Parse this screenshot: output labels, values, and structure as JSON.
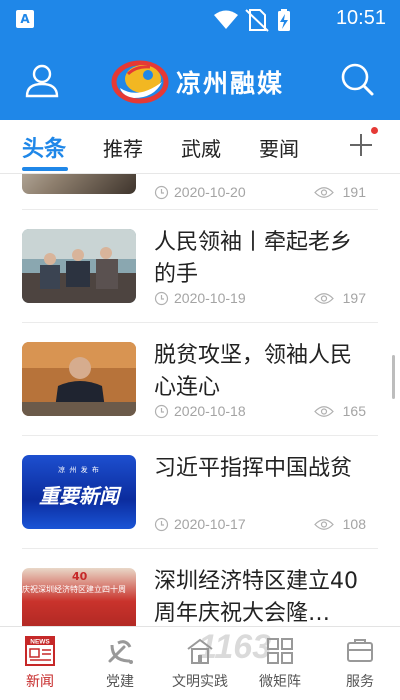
{
  "status_bar": {
    "time": "10:51"
  },
  "header": {
    "app_name": "凉州融媒"
  },
  "tabs": [
    {
      "label": "头条",
      "active": true
    },
    {
      "label": "推荐",
      "active": false
    },
    {
      "label": "武威",
      "active": false
    },
    {
      "label": "要闻",
      "active": false
    }
  ],
  "feed": {
    "items": [
      {
        "title": "",
        "date": "2020-10-20",
        "views": "191"
      },
      {
        "title": "人民领袖丨牵起老乡的手",
        "date": "2020-10-19",
        "views": "197"
      },
      {
        "title": "脱贫攻坚，领袖人民心连心",
        "date": "2020-10-18",
        "views": "165"
      },
      {
        "title": "习近平指挥中国战贫",
        "date": "2020-10-17",
        "views": "108"
      },
      {
        "title": "深圳经济特区建立40周年庆祝大会隆…",
        "date": "",
        "views": ""
      }
    ],
    "thumb_texts": {
      "news_banner": "重要新闻",
      "news_banner_small": "凉 州 发 布",
      "shenzhen_banner": "庆祝深圳经济特区建立四十周",
      "shenzhen_badge": "40"
    }
  },
  "bottom_nav": [
    {
      "label": "新闻",
      "icon": "news-icon",
      "icon_text": "NEWS",
      "active": true
    },
    {
      "label": "党建",
      "icon": "party-emblem-icon",
      "active": false
    },
    {
      "label": "文明实践",
      "icon": "civilization-practice-icon",
      "active": false
    },
    {
      "label": "微矩阵",
      "icon": "matrix-grid-icon",
      "active": false
    },
    {
      "label": "服务",
      "icon": "service-icon",
      "active": false
    }
  ],
  "colors": {
    "primary": "#1f87e8",
    "active_nav": "#c62828",
    "text": "#222222",
    "meta": "#a4a4a4"
  },
  "watermark": "1163"
}
